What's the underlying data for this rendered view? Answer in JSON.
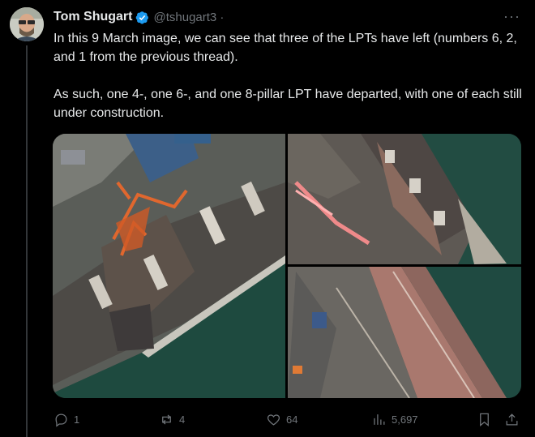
{
  "tweet": {
    "author_name": "Tom Shugart",
    "handle": "@tshugart3 ·",
    "more": "···",
    "text_p1": "In this 9 March image, we can see that three of the LPTs have left (numbers 6, 2, and 1 from the previous thread).",
    "text_p2": "As such, one 4-, one 6-, and one 8-pillar LPT have departed, with one of each still under construction."
  },
  "actions": {
    "replies": "1",
    "reposts": "4",
    "likes": "64",
    "views": "5,697"
  },
  "colors": {
    "background": "#000000",
    "text": "#e7e9ea",
    "muted": "#71767b",
    "verified": "#1d9bf0"
  },
  "icons": [
    "verified-badge-icon",
    "more-icon",
    "reply-icon",
    "repost-icon",
    "like-icon",
    "views-icon",
    "bookmark-icon",
    "share-icon"
  ]
}
